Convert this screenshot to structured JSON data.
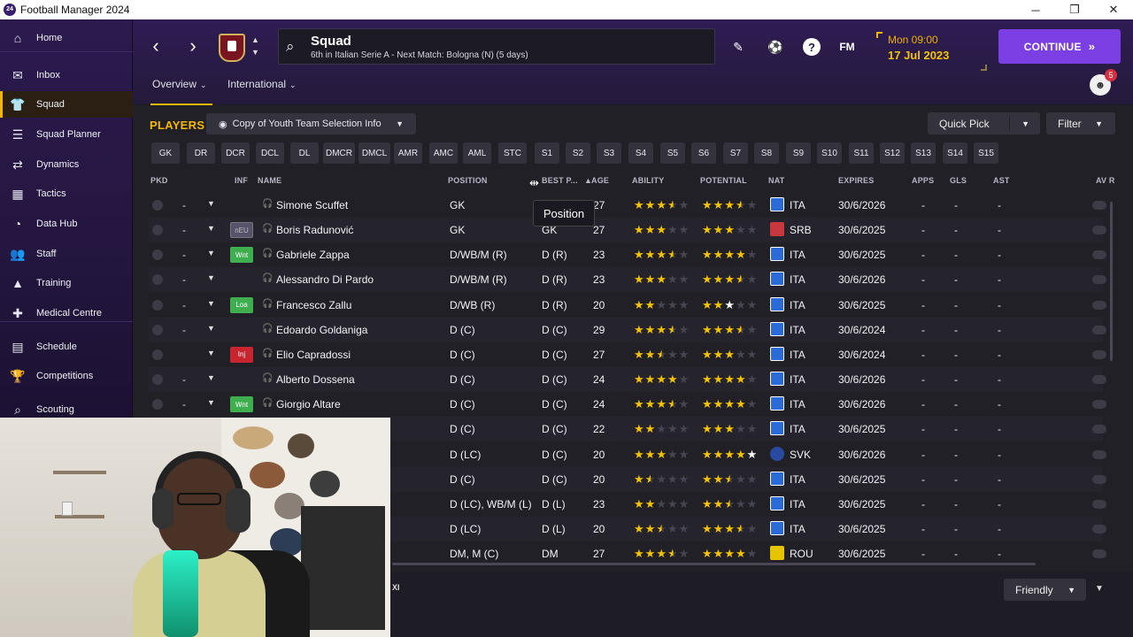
{
  "window": {
    "title": "Football Manager 2024",
    "app_icon": "24"
  },
  "sidebar": {
    "items": [
      {
        "label": "Home",
        "icon": "home-icon",
        "glyph": "⌂"
      },
      {
        "label": "Inbox",
        "icon": "inbox-icon",
        "glyph": "✉"
      },
      {
        "label": "Squad",
        "icon": "shirt-icon",
        "glyph": "👕",
        "active": true
      },
      {
        "label": "Squad Planner",
        "icon": "clipboard-icon",
        "glyph": "☰"
      },
      {
        "label": "Dynamics",
        "icon": "dynamics-icon",
        "glyph": "⇄"
      },
      {
        "label": "Tactics",
        "icon": "tactics-icon",
        "glyph": "▦"
      },
      {
        "label": "Data Hub",
        "icon": "data-hub-icon",
        "glyph": "◔"
      },
      {
        "label": "Staff",
        "icon": "staff-icon",
        "glyph": "👥"
      },
      {
        "label": "Training",
        "icon": "training-icon",
        "glyph": "▲"
      },
      {
        "label": "Medical Centre",
        "icon": "medical-icon",
        "glyph": "✚"
      },
      {
        "label": "Schedule",
        "icon": "calendar-icon",
        "glyph": "▤"
      },
      {
        "label": "Competitions",
        "icon": "trophy-icon",
        "glyph": "🏆"
      },
      {
        "label": "Scouting",
        "icon": "scouting-icon",
        "glyph": "⌕"
      }
    ]
  },
  "header": {
    "page_title": "Squad",
    "subtitle": "6th in Italian Serie A - Next Match: Bologna (N) (5 days)",
    "time": "Mon 09:00",
    "date": "17 Jul 2023",
    "continue_label": "CONTINUE",
    "fm_label": "FM",
    "help_label": "?",
    "notifications": "5",
    "tabs": [
      {
        "label": "Overview",
        "active": true
      },
      {
        "label": "International"
      }
    ]
  },
  "toolbar": {
    "players_label": "PLAYERS",
    "selection_info": "Copy of Youth Team Selection Info",
    "quick_pick": "Quick Pick",
    "filter": "Filter"
  },
  "position_filters": [
    "GK",
    "DR",
    "DCR",
    "DCL",
    "DL",
    "DMCR",
    "DMCL",
    "AMR",
    "AMC",
    "AML",
    "STC",
    "S1",
    "S2",
    "S3",
    "S4",
    "S5",
    "S6",
    "S7",
    "S8",
    "S9",
    "S10",
    "S11",
    "S12",
    "S13",
    "S14",
    "S15"
  ],
  "table": {
    "headers": {
      "pkd": "PKD",
      "inf": "INF",
      "name": "NAME",
      "position": "POSITION",
      "best_pos": "BEST P...",
      "age": "AGE",
      "ability": "ABILITY",
      "potential": "POTENTIAL",
      "nat": "NAT",
      "expires": "EXPIRES",
      "apps": "APPS",
      "gls": "GLS",
      "ast": "AST",
      "av_rat": "AV R"
    },
    "tooltip": "Position",
    "rows": [
      {
        "pkd": "-",
        "inf": "",
        "name": "Simone Scuffet",
        "position": "GK",
        "best": "GK",
        "age": "27",
        "ability": 3.5,
        "potential": 3.5,
        "nat": "ITA",
        "flag": "ita",
        "expires": "30/6/2026",
        "apps": "-",
        "gls": "-",
        "ast": "-"
      },
      {
        "pkd": "-",
        "inf": "nEU",
        "name": "Boris Radunović",
        "position": "GK",
        "best": "GK",
        "age": "27",
        "ability": 3,
        "potential": 3,
        "nat": "SRB",
        "flag": "srb",
        "expires": "30/6/2025",
        "apps": "-",
        "gls": "-",
        "ast": "-"
      },
      {
        "pkd": "-",
        "inf": "Wnt",
        "name": "Gabriele Zappa",
        "position": "D/WB/M (R)",
        "best": "D (R)",
        "age": "23",
        "ability": 3.5,
        "potential": 4,
        "nat": "ITA",
        "flag": "ita",
        "expires": "30/6/2025",
        "apps": "-",
        "gls": "-",
        "ast": "-"
      },
      {
        "pkd": "-",
        "inf": "",
        "name": "Alessandro Di Pardo",
        "position": "D/WB/M (R)",
        "best": "D (R)",
        "age": "23",
        "ability": 3,
        "potential": 3.5,
        "nat": "ITA",
        "flag": "ita",
        "expires": "30/6/2026",
        "apps": "-",
        "gls": "-",
        "ast": "-"
      },
      {
        "pkd": "-",
        "inf": "Loa",
        "name": "Francesco Zallu",
        "position": "D/WB (R)",
        "best": "D (R)",
        "age": "20",
        "ability": 2,
        "potential": 2.5,
        "nat": "ITA",
        "flag": "ita",
        "expires": "30/6/2025",
        "apps": "-",
        "gls": "-",
        "ast": "-"
      },
      {
        "pkd": "-",
        "inf": "",
        "name": "Edoardo Goldaniga",
        "position": "D (C)",
        "best": "D (C)",
        "age": "29",
        "ability": 3.5,
        "potential": 3.5,
        "nat": "ITA",
        "flag": "ita",
        "expires": "30/6/2024",
        "apps": "-",
        "gls": "-",
        "ast": "-"
      },
      {
        "pkd": "",
        "inf": "Inj",
        "name": "Elio Capradossi",
        "position": "D (C)",
        "best": "D (C)",
        "age": "27",
        "ability": 2.5,
        "potential": 3,
        "nat": "ITA",
        "flag": "ita",
        "expires": "30/6/2024",
        "apps": "-",
        "gls": "-",
        "ast": "-"
      },
      {
        "pkd": "-",
        "inf": "",
        "name": "Alberto Dossena",
        "position": "D (C)",
        "best": "D (C)",
        "age": "24",
        "ability": 4,
        "potential": 4,
        "nat": "ITA",
        "flag": "ita",
        "expires": "30/6/2026",
        "apps": "-",
        "gls": "-",
        "ast": "-"
      },
      {
        "pkd": "-",
        "inf": "Wnt",
        "name": "Giorgio Altare",
        "position": "D (C)",
        "best": "D (C)",
        "age": "24",
        "ability": 3.5,
        "potential": 4,
        "nat": "ITA",
        "flag": "ita",
        "expires": "30/6/2026",
        "apps": "-",
        "gls": "-",
        "ast": "-"
      },
      {
        "pkd": "",
        "inf": "",
        "name": "",
        "position": "D (C)",
        "best": "D (C)",
        "age": "22",
        "ability": 2,
        "potential": 3,
        "nat": "ITA",
        "flag": "ita",
        "expires": "30/6/2025",
        "apps": "-",
        "gls": "-",
        "ast": "-"
      },
      {
        "pkd": "",
        "inf": "",
        "name": "",
        "position": "D (LC)",
        "best": "D (C)",
        "age": "20",
        "ability": 3,
        "potential": 4.5,
        "nat": "SVK",
        "flag": "svk",
        "expires": "30/6/2026",
        "apps": "-",
        "gls": "-",
        "ast": "-"
      },
      {
        "pkd": "",
        "inf": "",
        "name": "",
        "position": "D (C)",
        "best": "D (C)",
        "age": "20",
        "ability": 1.5,
        "potential": 2.5,
        "nat": "ITA",
        "flag": "ita",
        "expires": "30/6/2025",
        "apps": "-",
        "gls": "-",
        "ast": "-"
      },
      {
        "pkd": "",
        "inf": "",
        "name": "",
        "position": "D (LC), WB/M (L)",
        "best": "D (L)",
        "age": "23",
        "ability": 2,
        "potential": 2.5,
        "nat": "ITA",
        "flag": "ita",
        "expires": "30/6/2025",
        "apps": "-",
        "gls": "-",
        "ast": "-"
      },
      {
        "pkd": "",
        "inf": "",
        "name": "",
        "position": "D (LC)",
        "best": "D (L)",
        "age": "20",
        "ability": 2.5,
        "potential": 3.5,
        "nat": "ITA",
        "flag": "ita",
        "expires": "30/6/2025",
        "apps": "-",
        "gls": "-",
        "ast": "-"
      },
      {
        "pkd": "",
        "inf": "",
        "name": "",
        "position": "DM, M (C)",
        "best": "DM",
        "age": "27",
        "ability": 3.5,
        "potential": 4,
        "nat": "ROU",
        "flag": "rou",
        "expires": "30/6/2025",
        "apps": "-",
        "gls": "-",
        "ast": "-"
      }
    ]
  },
  "footer": {
    "friendly": "Friendly",
    "xi_label": "XI"
  },
  "colors": {
    "accent": "#f5b800",
    "continue": "#7b3fe4",
    "sidebar": "#2b1a4e",
    "background": "#222027"
  }
}
